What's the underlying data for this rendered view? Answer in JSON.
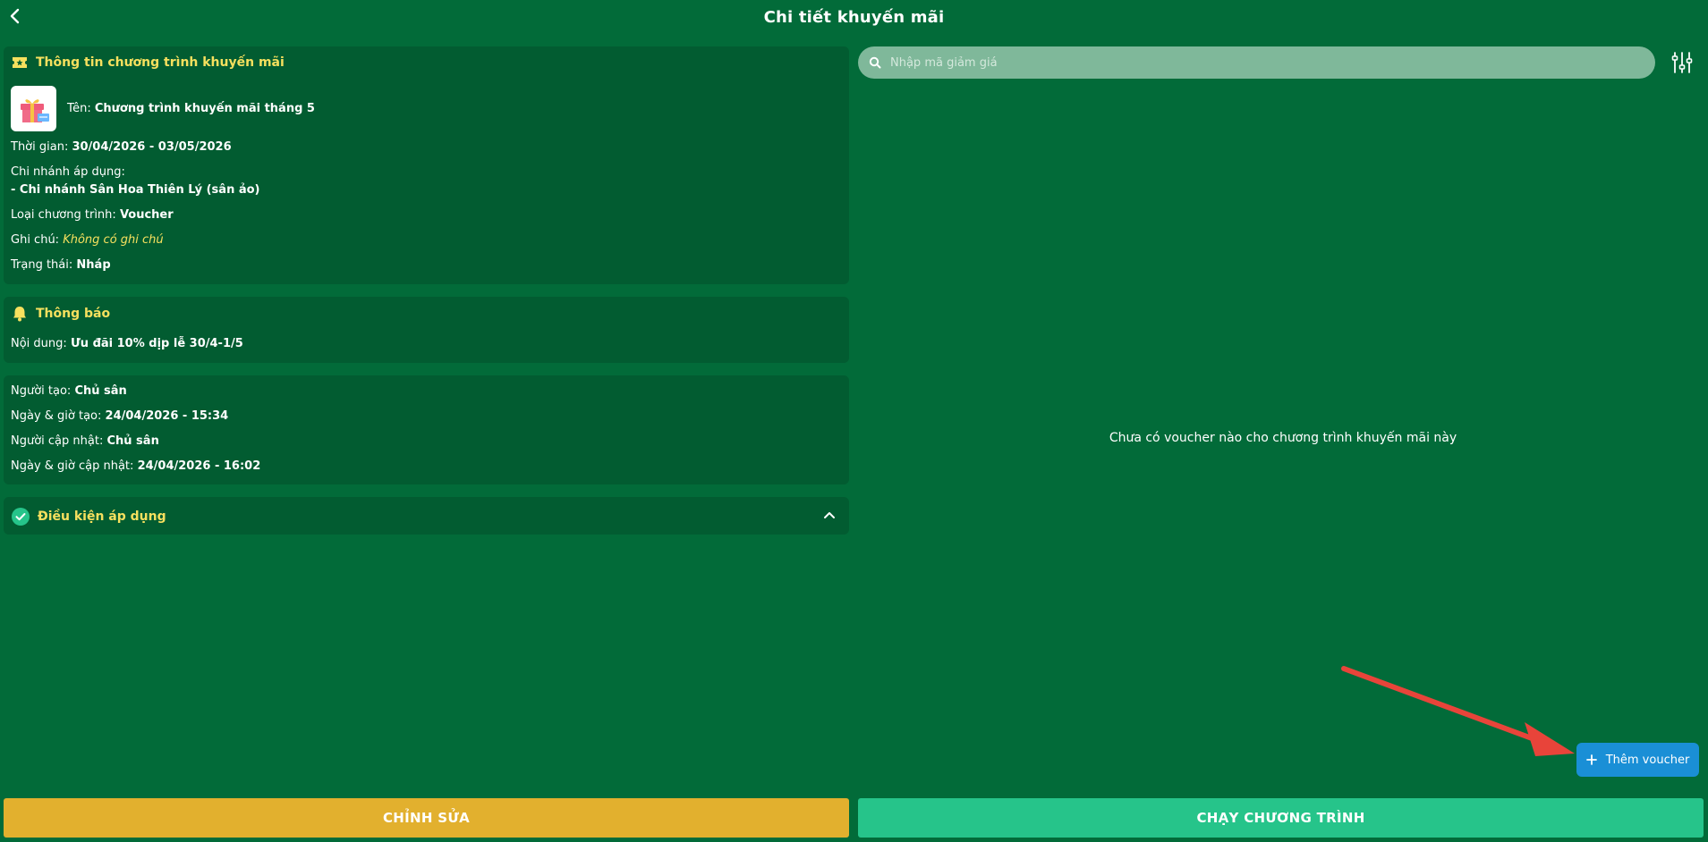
{
  "header": {
    "title": "Chi tiết khuyến mãi"
  },
  "info": {
    "heading": "Thông tin chương trình khuyến mãi",
    "name_label": "Tên:",
    "name_value": "Chương trình khuyến mãi tháng 5",
    "time_label": "Thời gian:",
    "time_value": "30/04/2026 - 03/05/2026",
    "branch_label": "Chi nhánh áp dụng:",
    "branch_value": "- Chi nhánh Sân Hoa Thiên Lý (sân ảo)",
    "type_label": "Loại chương trình:",
    "type_value": "Voucher",
    "note_label": "Ghi chú:",
    "note_value": "Không có ghi chú",
    "status_label": "Trạng thái:",
    "status_value": "Nháp"
  },
  "notice": {
    "heading": "Thông báo",
    "content_label": "Nội dung:",
    "content_value": "Ưu đãi 10% dịp lễ 30/4-1/5"
  },
  "meta": {
    "creator_label": "Người tạo:",
    "creator_value": "Chủ sân",
    "created_label": "Ngày & giờ tạo:",
    "created_value": "24/04/2026 - 15:34",
    "updater_label": "Người cập nhật:",
    "updater_value": "Chủ sân",
    "updated_label": "Ngày & giờ cập nhật:",
    "updated_value": "24/04/2026 - 16:02"
  },
  "conditions": {
    "heading": "Điều kiện áp dụng"
  },
  "search": {
    "placeholder": "Nhập mã giảm giá"
  },
  "vouchers": {
    "empty_message": "Chưa có voucher nào cho chương trình khuyến mãi này"
  },
  "actions": {
    "add_voucher": "Thêm voucher",
    "edit": "CHỈNH SỬA",
    "run": "CHẠY CHƯƠNG TRÌNH"
  },
  "colors": {
    "background": "#026b39",
    "card": "#025c31",
    "accent_yellow": "#f6e05e",
    "edit_button": "#e2b02e",
    "run_button": "#26c48a",
    "add_button": "#1a8fd6",
    "annotation_arrow": "#e8443a"
  },
  "icons": {
    "back": "chevron-left-icon",
    "ticket": "ticket-icon",
    "gift": "gift-icon",
    "bell": "bell-icon",
    "check": "check-circle-icon",
    "collapse": "chevron-up-icon",
    "search": "search-icon",
    "filter": "sliders-icon",
    "plus": "plus-icon"
  }
}
